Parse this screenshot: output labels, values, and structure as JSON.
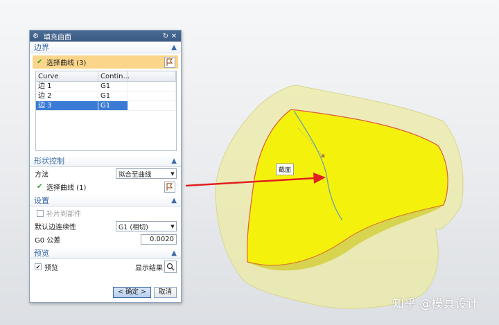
{
  "dialog": {
    "title": "填充曲面",
    "boundary": {
      "header": "边界",
      "select_label": "选择曲线 (3)",
      "columns": [
        "Curve",
        "Contin..."
      ],
      "rows": [
        {
          "curve": "边 1",
          "cont": "G1"
        },
        {
          "curve": "边 2",
          "cont": "G1"
        },
        {
          "curve": "边 3",
          "cont": "G1"
        }
      ]
    },
    "shape": {
      "header": "形状控制",
      "method_label": "方法",
      "method_value": "拟合至曲线",
      "select_label": "选择曲线 (1)"
    },
    "settings": {
      "header": "设置",
      "patch_label": "补片到部件",
      "continuity_label": "默认边连续性",
      "continuity_value": "G1 (相切)",
      "tolerance_label": "G0 公差",
      "tolerance_value": "0.0020"
    },
    "preview": {
      "header": "预览",
      "preview_label": "预览",
      "show_result_label": "显示结果"
    },
    "buttons": {
      "ok": "< 确定 >",
      "cancel": "取消"
    }
  },
  "viewport": {
    "section_label": "截面",
    "watermark": "知乎 @模具设计"
  },
  "colors": {
    "surface_yellow": "#f4f20c",
    "boundary_red": "#e05a3c",
    "arrow_red": "#e02020",
    "title_blue": "#3a5a83"
  }
}
